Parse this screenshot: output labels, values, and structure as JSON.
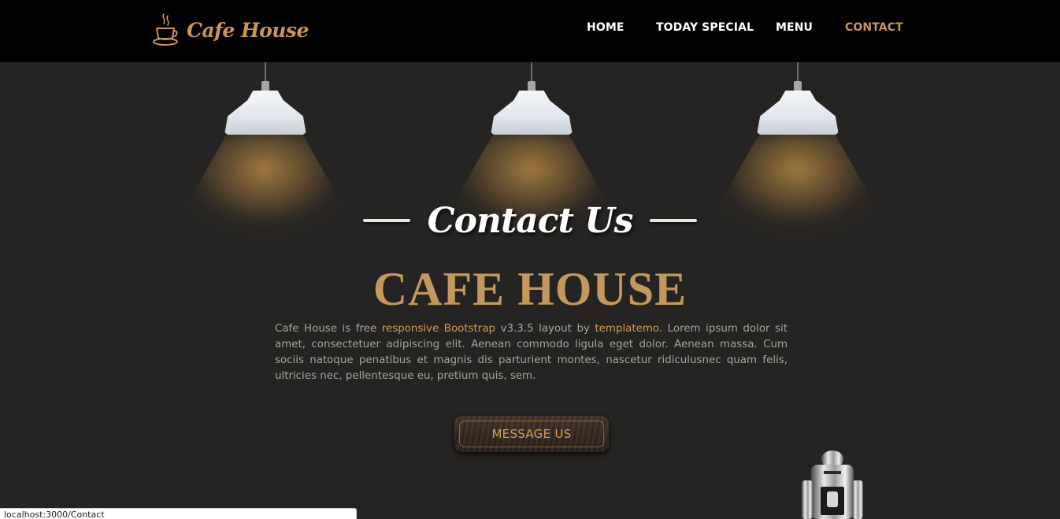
{
  "header": {
    "logo_text": "Cafe House",
    "nav": [
      {
        "label": "HOME",
        "active": false
      },
      {
        "label": "TODAY SPECIAL",
        "active": false
      },
      {
        "label": "MENU",
        "active": false
      },
      {
        "label": "CONTACT",
        "active": true
      }
    ]
  },
  "hero": {
    "section_title": "Contact Us",
    "heading": "CAFE HOUSE",
    "lead_parts": {
      "p1": "Cafe House is free ",
      "link1": "responsive Bootstrap",
      "p2": " v3.3.5 layout by ",
      "link2": "templatemo",
      "p3": ". Lorem ipsum dolor sit amet, consectetuer adipiscing elit. Aenean commodo ligula eget dolor. Aenean massa. Cum sociis natoque penatibus et magnis dis parturient montes, nascetur ridiculusnec quam felis, ultricies nec, pellentesque eu, pretium quis, sem."
    },
    "button_label": "MESSAGE US"
  },
  "status_bar": {
    "url": "localhost:3000/Contact"
  },
  "colors": {
    "background": "#252423",
    "topbar": "#020202",
    "accent": "#c8955a",
    "heading_gold": "#c4975d",
    "text": "#a7a39d"
  },
  "icons": [
    "coffee-cup-icon"
  ]
}
